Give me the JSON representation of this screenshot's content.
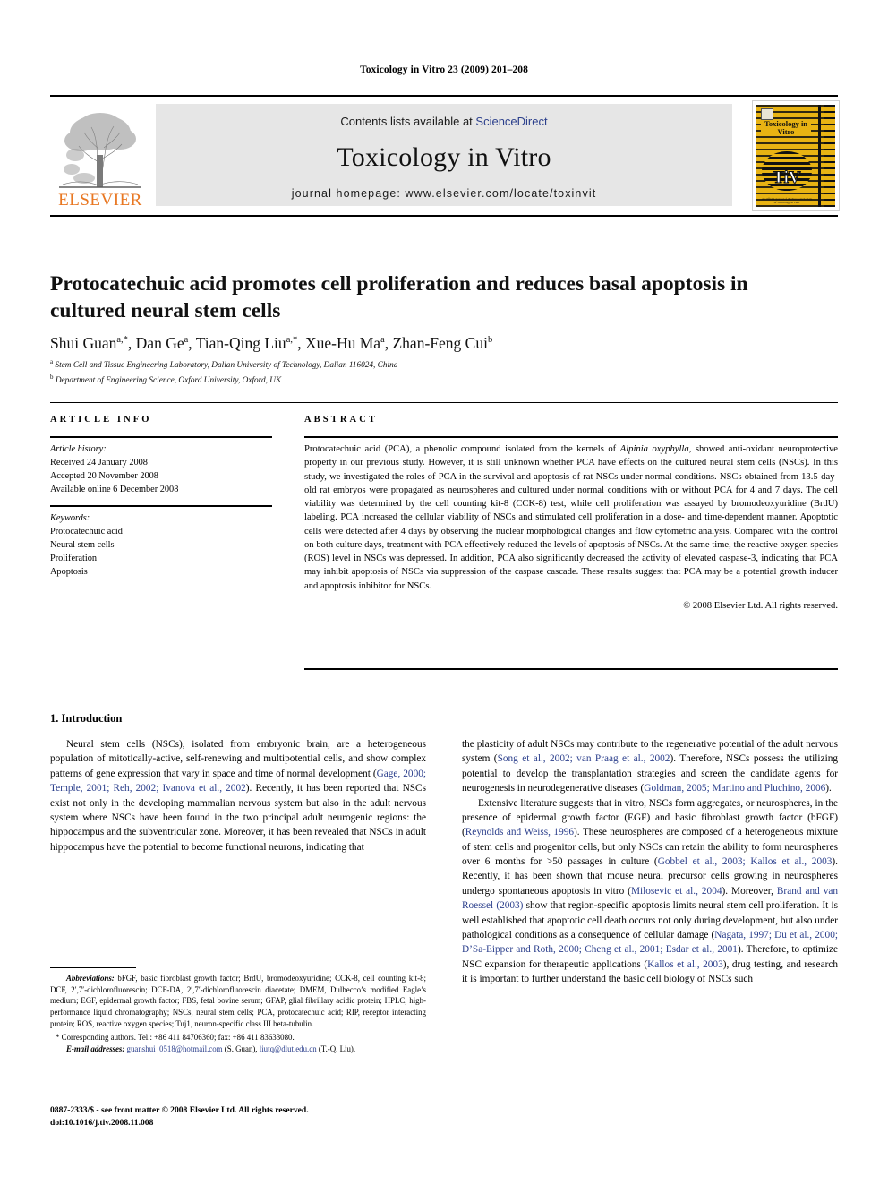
{
  "runhead": "Toxicology in Vitro 23 (2009) 201–208",
  "masthead": {
    "contents_prefix": "Contents lists available at ",
    "sciencedirect": "ScienceDirect",
    "journal_title": "Toxicology in Vitro",
    "homepage": "journal homepage: www.elsevier.com/locate/toxinvit",
    "publisher_logo_text": "ELSEVIER",
    "cover_title": "Toxicology in Vitro",
    "cover_monogram": "TiV",
    "cover_footnote": "An Official Journal of the European Society of Toxicology in Vitro",
    "accent_orange": "#E87722",
    "cover_yellow": "#E8B313",
    "band_gray": "#E6E6E6",
    "link_blue": "#2B3F8C"
  },
  "article": {
    "title": "Protocatechuic acid promotes cell proliferation and reduces basal apoptosis in cultured neural stem cells",
    "authors_html": "Shui Guan<sup>a,*</sup>, Dan Ge<sup>a</sup>, Tian-Qing Liu<sup>a,*</sup>, Xue-Hu Ma<sup>a</sup>, Zhan-Feng Cui<sup>b</sup>",
    "affiliation_a": "Stem Cell and Tissue Engineering Laboratory, Dalian University of Technology, Dalian 116024, China",
    "affiliation_b": "Department of Engineering Science, Oxford University, Oxford, UK"
  },
  "info": {
    "heading": "ARTICLE INFO",
    "history_label": "Article history:",
    "history": [
      "Received 24 January 2008",
      "Accepted 20 November 2008",
      "Available online 6 December 2008"
    ],
    "keywords_label": "Keywords:",
    "keywords": [
      "Protocatechuic acid",
      "Neural stem cells",
      "Proliferation",
      "Apoptosis"
    ]
  },
  "abstract": {
    "heading": "ABSTRACT",
    "text_before_italic": "Protocatechuic acid (PCA), a phenolic compound isolated from the kernels of ",
    "italic_species": "Alpinia oxyphylla",
    "text_after_italic": ", showed anti-oxidant neuroprotective property in our previous study. However, it is still unknown whether PCA have effects on the cultured neural stem cells (NSCs). In this study, we investigated the roles of PCA in the survival and apoptosis of rat NSCs under normal conditions. NSCs obtained from 13.5-day-old rat embryos were propagated as neurospheres and cultured under normal conditions with or without PCA for 4 and 7 days. The cell viability was determined by the cell counting kit-8 (CCK-8) test, while cell proliferation was assayed by bromodeoxyuridine (BrdU) labeling. PCA increased the cellular viability of NSCs and stimulated cell proliferation in a dose- and time-dependent manner. Apoptotic cells were detected after 4 days by observing the nuclear morphological changes and flow cytometric analysis. Compared with the control on both culture days, treatment with PCA effectively reduced the levels of apoptosis of NSCs. At the same time, the reactive oxygen species (ROS) level in NSCs was depressed. In addition, PCA also significantly decreased the activity of elevated caspase-3, indicating that PCA may inhibit apoptosis of NSCs via suppression of the caspase cascade. These results suggest that PCA may be a potential growth inducer and apoptosis inhibitor for NSCs.",
    "copyright": "© 2008 Elsevier Ltd. All rights reserved."
  },
  "body": {
    "section_title": "1. Introduction",
    "left_p1_a": "Neural stem cells (NSCs), isolated from embryonic brain, are a heterogeneous population of mitotically-active, self-renewing and multipotential cells, and show complex patterns of gene expression that vary in space and time of normal development (",
    "left_p1_cite1": "Gage, 2000; Temple, 2001; Reh, 2002; Ivanova et al., 2002",
    "left_p1_b": "). Recently, it has been reported that NSCs exist not only in the developing mammalian nervous system but also in the adult nervous system where NSCs have been found in the two principal adult neurogenic regions: the hippocampus and the subventricular zone. Moreover, it has been revealed that NSCs in adult hippocampus have the potential to become functional neurons, indicating that",
    "right_p1_a": "the plasticity of adult NSCs may contribute to the regenerative potential of the adult nervous system (",
    "right_p1_cite1": "Song et al., 2002; van Praag et al., 2002",
    "right_p1_b": "). Therefore, NSCs possess the utilizing potential to develop the transplantation strategies and screen the candidate agents for neurogenesis in neurodegenerative diseases (",
    "right_p1_cite2": "Goldman, 2005; Martino and Pluchino, 2006",
    "right_p1_c": ").",
    "right_p2_a": "Extensive literature suggests that in vitro, NSCs form aggregates, or neurospheres, in the presence of epidermal growth factor (EGF) and basic fibroblast growth factor (bFGF) (",
    "right_p2_cite1": "Reynolds and Weiss, 1996",
    "right_p2_b": "). These neurospheres are composed of a heterogeneous mixture of stem cells and progenitor cells, but only NSCs can retain the ability to form neurospheres over 6 months for >50 passages in culture (",
    "right_p2_cite2": "Gobbel et al., 2003; Kallos et al., 2003",
    "right_p2_c": "). Recently, it has been shown that mouse neural precursor cells growing in neurospheres undergo spontaneous apoptosis in vitro (",
    "right_p2_cite3": "Milosevic et al., 2004",
    "right_p2_d": "). Moreover, ",
    "right_p2_cite4": "Brand and van Roessel (2003)",
    "right_p2_e": " show that region-specific apoptosis limits neural stem cell proliferation. It is well established that apoptotic cell death occurs not only during development, but also under pathological conditions as a consequence of cellular damage (",
    "right_p2_cite5": "Nagata, 1997; Du et al., 2000; D’Sa-Eipper and Roth, 2000; Cheng et al., 2001; Esdar et al., 2001",
    "right_p2_f": "). Therefore, to optimize NSC expansion for therapeutic applications (",
    "right_p2_cite6": "Kallos et al., 2003",
    "right_p2_g": "), drug testing, and research it is important to further understand the basic cell biology of NSCs such"
  },
  "footnotes": {
    "abbr_label": "Abbreviations:",
    "abbr_text": " bFGF, basic fibroblast growth factor; BrdU, bromodeoxyuridine; CCK-8, cell counting kit-8; DCF, 2′,7′-dichlorofluorescin; DCF-DA, 2′,7′-dichlorofluorescin diacetate; DMEM, Dulbecco’s modified Eagle’s medium; EGF, epidermal growth factor; FBS, fetal bovine serum; GFAP, glial fibrillary acidic protein; HPLC, high-performance liquid chromatography; NSCs, neural stem cells; PCA, protocatechuic acid; RIP, receptor interacting protein; ROS, reactive oxygen species; Tuj1, neuron-specific class III beta-tubulin.",
    "corresponding": "Corresponding authors. Tel.: +86 411 84706360; fax: +86 411 83633080.",
    "email_label": "E-mail addresses:",
    "email_1": "guanshui_0518@hotmail.com",
    "email_1_owner": " (S. Guan), ",
    "email_2": "liutq@dlut.edu.cn",
    "email_2_owner": " (T.-Q. Liu)."
  },
  "page_footer": {
    "line1": "0887-2333/$ - see front matter © 2008 Elsevier Ltd. All rights reserved.",
    "line2": "doi:10.1016/j.tiv.2008.11.008"
  }
}
